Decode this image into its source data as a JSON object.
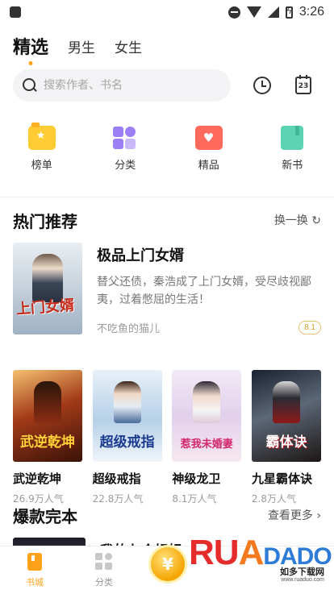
{
  "status_bar": {
    "time": "3:26"
  },
  "top_tabs": [
    {
      "label": "精选",
      "active": true
    },
    {
      "label": "男生",
      "active": false
    },
    {
      "label": "女生",
      "active": false
    }
  ],
  "search": {
    "placeholder": "搜索作者、书名"
  },
  "toolbar": {
    "calendar_day": "23"
  },
  "quick_nav": [
    {
      "label": "榜单",
      "icon": "trophy-icon"
    },
    {
      "label": "分类",
      "icon": "category-icon"
    },
    {
      "label": "精品",
      "icon": "heart-icon"
    },
    {
      "label": "新书",
      "icon": "book-icon"
    }
  ],
  "hot_section": {
    "title": "热门推荐",
    "action": "换一换",
    "action_icon": "refresh-icon",
    "featured": {
      "cover_text": "上门女婿",
      "title": "极品上门女婿",
      "description": "替父还债，秦浩成了上门女婿，受尽歧视鄙夷，过着憋屈的生活！",
      "author": "不吃鱼的猫儿",
      "score": "8.1"
    },
    "books": [
      {
        "cover_text": "武逆乾坤",
        "title": "武逆乾坤",
        "popularity": "26.9万人气"
      },
      {
        "cover_text": "超级戒指",
        "title": "超级戒指",
        "popularity": "22.8万人气"
      },
      {
        "cover_text": "惹我未婚妻",
        "title": "神级龙卫",
        "popularity": "8.1万人气"
      },
      {
        "cover_text": "霸体诀",
        "title": "九星霸体诀",
        "popularity": "2.8万人气"
      }
    ]
  },
  "complete_section": {
    "title": "爆款完本",
    "action": "查看更多",
    "peek_title": "我的七个姐姐"
  },
  "bottom_nav": [
    {
      "label": "书城",
      "active": true
    },
    {
      "label": "分类",
      "active": false
    }
  ],
  "watermark": {
    "text_1": "RU",
    "text_2": "A",
    "text_3": "DADO",
    "sub": "如多下载网",
    "url": "www.ruaduo.com"
  },
  "colors": {
    "accent": "#ffa21a",
    "score": "#d89a2a"
  }
}
